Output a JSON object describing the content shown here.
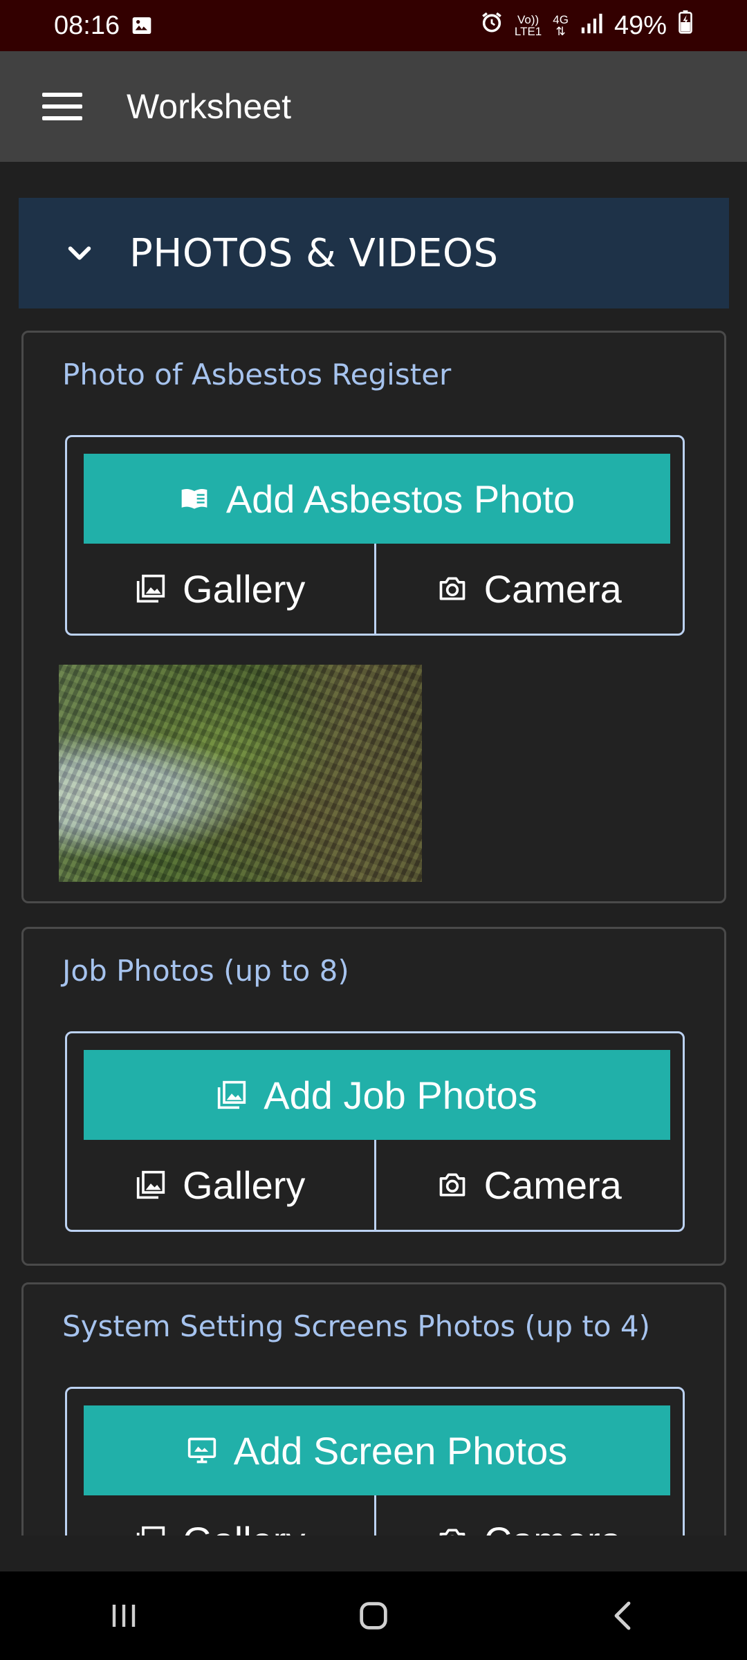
{
  "status_bar": {
    "time": "08:16",
    "volte_top": "Vo))",
    "volte_bottom": "LTE1",
    "network": "4G",
    "battery": "49%",
    "icons": [
      "image-icon",
      "alarm-icon",
      "signal-icon",
      "battery-charging-icon"
    ]
  },
  "app_bar": {
    "title": "Worksheet",
    "menu_icon": "hamburger-menu-icon"
  },
  "section": {
    "title": "PHOTOS & VIDEOS",
    "icon": "chevron-down-icon"
  },
  "cards": [
    {
      "title": "Photo of Asbestos Register",
      "add_label": "Add Asbestos Photo",
      "add_icon": "book-open-icon",
      "gallery_label": "Gallery",
      "camera_label": "Camera"
    },
    {
      "title": "Job Photos (up to 8)",
      "add_label": "Add Job Photos",
      "add_icon": "images-icon",
      "gallery_label": "Gallery",
      "camera_label": "Camera"
    },
    {
      "title": "System Setting Screens Photos (up to 4)",
      "add_label": "Add Screen Photos",
      "add_icon": "monitor-icon",
      "gallery_label": "Gallery",
      "camera_label": "Camera"
    }
  ],
  "colors": {
    "accent_teal": "#21b0a9",
    "section_header_bg": "#1e3248",
    "card_title": "#a6c3ee",
    "status_bar_bg": "#330000",
    "app_bar_bg": "#414141"
  }
}
